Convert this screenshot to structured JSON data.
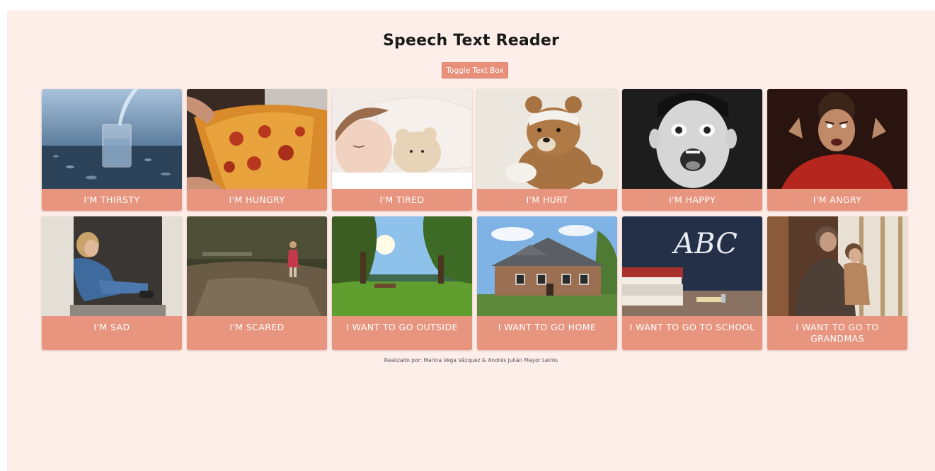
{
  "header": {
    "title": "Speech Text Reader",
    "toggle_label": "Toggle Text Box"
  },
  "cards": [
    {
      "label": "I'M THIRSTY",
      "image": "glass-of-water-image"
    },
    {
      "label": "I'M HUNGRY",
      "image": "pizza-image"
    },
    {
      "label": "I'M TIRED",
      "image": "sleeping-child-image"
    },
    {
      "label": "I'M HURT",
      "image": "bandaged-teddy-bear-image"
    },
    {
      "label": "I'M HAPPY",
      "image": "excited-boy-image"
    },
    {
      "label": "I'M ANGRY",
      "image": "angry-boy-image"
    },
    {
      "label": "I'M SAD",
      "image": "sad-girl-doorway-image"
    },
    {
      "label": "I'M SCARED",
      "image": "child-in-forest-image"
    },
    {
      "label": "I WANT TO GO OUTSIDE",
      "image": "park-sunlight-image"
    },
    {
      "label": "I WANT TO GO HOME",
      "image": "house-image"
    },
    {
      "label": "I WANT TO GO TO SCHOOL",
      "image": "chalkboard-abc-image"
    },
    {
      "label": "I WANT TO GO TO GRANDMAS",
      "image": "grandmother-child-image"
    }
  ],
  "chalkboard_text": "ABC",
  "footer": {
    "credit": "Realizado por: Marina Vega Vázquez & Andrés Julián Mayor Leirós"
  },
  "colors": {
    "page_background": "#fdeee9",
    "card_accent": "#e8957f",
    "button": "#e8907a"
  }
}
